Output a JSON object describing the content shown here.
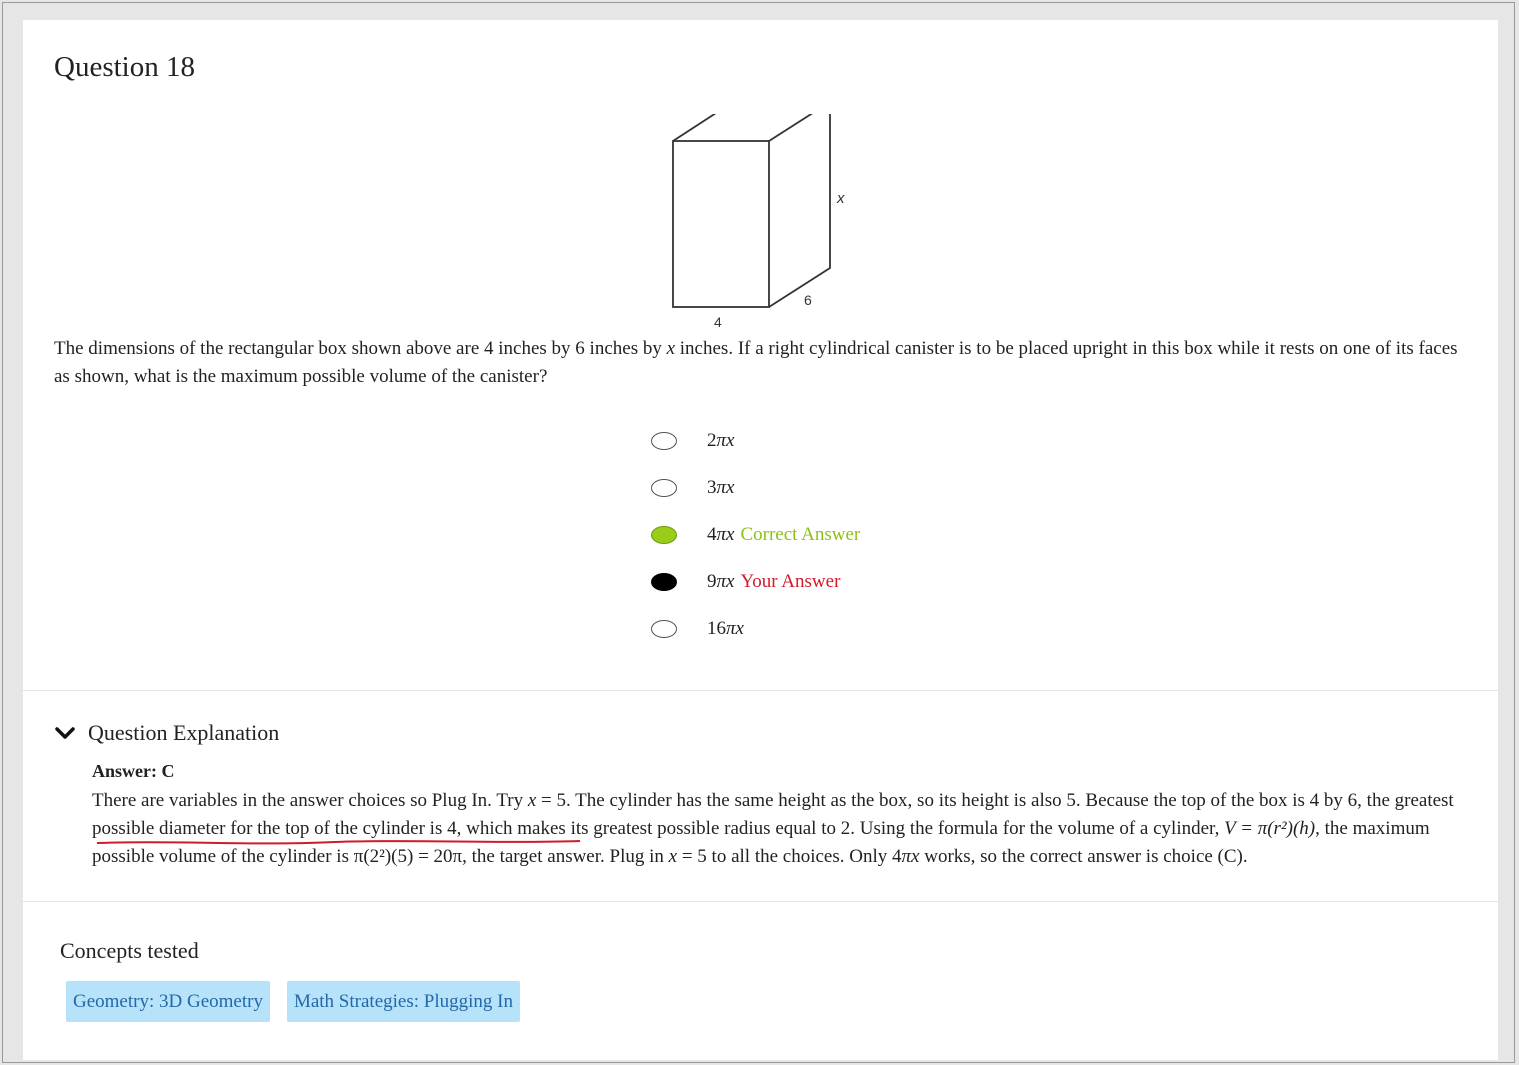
{
  "question": {
    "title": "Question 18",
    "figure": {
      "label_x": "x",
      "label_width": "4",
      "label_depth": "6"
    },
    "prompt": {
      "part1": "The dimensions of the rectangular box shown above are 4 inches by 6 inches by ",
      "var": "x",
      "part2": " inches. If a right cylindrical canister is to be placed upright in this box while it rests on one of its faces as shown, what is the maximum possible volume of the canister?"
    },
    "choices": [
      {
        "coef": "2",
        "expr": "πx",
        "tag": "",
        "state": "none"
      },
      {
        "coef": "3",
        "expr": "πx",
        "tag": "",
        "state": "none"
      },
      {
        "coef": "4",
        "expr": "πx",
        "tag": "Correct Answer",
        "state": "correct"
      },
      {
        "coef": "9",
        "expr": "πx",
        "tag": "Your Answer",
        "state": "selected"
      },
      {
        "coef": "16",
        "expr": "πx",
        "tag": "",
        "state": "none"
      }
    ]
  },
  "explanation": {
    "header": "Question Explanation",
    "answer_label": "Answer: C",
    "text": {
      "a": "There are variables in the answer choices so Plug In. Try ",
      "a_var": "x",
      "b": " = 5. The cylinder has the same height as the box, so its height is also 5. Because the top of the box is 4 by 6, the greatest possible diameter for the top of the cylinder is 4, which makes its greatest possible radius equal to 2. Using the formula for the volume of a cylinder, ",
      "formula": "V = π(r²)(h)",
      "c": ", the maximum possible volume of the cylinder is π(2²)(5) = 20π, the target answer. Plug in ",
      "c_var": "x",
      "d": " = 5 to all the choices. Only 4",
      "d_expr": "πx",
      "e": " works, so the correct answer is choice (C)."
    }
  },
  "concepts": {
    "title": "Concepts tested",
    "tags": [
      "Geometry: 3D Geometry",
      "Math Strategies: Plugging In"
    ]
  },
  "colors": {
    "correct": "#8cc215",
    "your_answer": "#d11a2a",
    "chip_bg": "#b6e2fa",
    "chip_text": "#2468a8"
  }
}
